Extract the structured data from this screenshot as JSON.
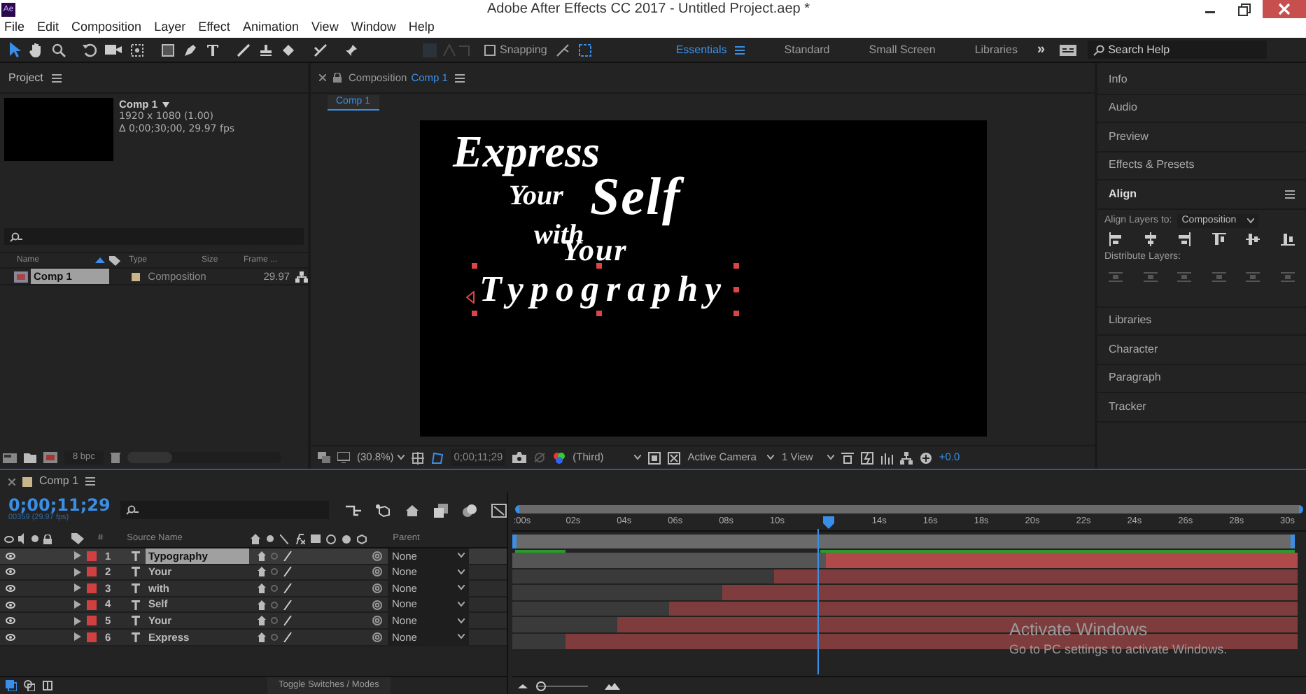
{
  "title_bar": {
    "app_icon": "Ae",
    "title": "Adobe After Effects CC 2017 - Untitled Project.aep *"
  },
  "menu": [
    "File",
    "Edit",
    "Composition",
    "Layer",
    "Effect",
    "Animation",
    "View",
    "Window",
    "Help"
  ],
  "toolbar": {
    "snapping": {
      "label": "Snapping",
      "checked": false
    },
    "workspaces": [
      {
        "label": "Essentials",
        "selected": true
      },
      {
        "label": "Standard",
        "selected": false
      },
      {
        "label": "Small Screen",
        "selected": false
      },
      {
        "label": "Libraries",
        "selected": false
      }
    ],
    "overflow": "»",
    "search": {
      "placeholder": "Search Help"
    }
  },
  "project": {
    "title": "Project",
    "comp_name": "Comp 1",
    "dimensions": "1920 x 1080 (1.00)",
    "duration": "Δ 0;00;30;00, 29.97 fps",
    "columns": [
      "Name",
      "Type",
      "Size",
      "Frame ..."
    ],
    "items": [
      {
        "name": "Comp 1",
        "type": "Composition",
        "frame_rate": "29.97",
        "selected": true
      }
    ],
    "bit_depth": "8 bpc",
    "thumbnail_slider": {
      "level": 0.0
    }
  },
  "viewer": {
    "tab_label": "Composition",
    "tab_comp": "Comp 1",
    "breadcrumb": "Comp 1",
    "canvas_texts": [
      "Express",
      "Your",
      "Self",
      "with",
      "Your",
      "Typography"
    ],
    "zoom": "(30.8%)",
    "timecode": "0;00;11;29",
    "resolution": "(Third)",
    "camera": "Active Camera",
    "views": "1 View",
    "exposure": "+0.0"
  },
  "right_panel": {
    "panels": [
      {
        "label": "Info",
        "expanded": false
      },
      {
        "label": "Audio",
        "expanded": false
      },
      {
        "label": "Preview",
        "expanded": false
      },
      {
        "label": "Effects & Presets",
        "expanded": false
      },
      {
        "label": "Align",
        "expanded": true
      },
      {
        "label": "Libraries",
        "expanded": false
      },
      {
        "label": "Character",
        "expanded": false
      },
      {
        "label": "Paragraph",
        "expanded": false
      },
      {
        "label": "Tracker",
        "expanded": false
      }
    ],
    "align_to_label": "Align Layers to:",
    "align_to": "Composition",
    "distribute_label": "Distribute Layers:"
  },
  "timeline": {
    "tab": "Comp 1",
    "timecode": "0;00;11;29",
    "frame_info": "00359 (29.97 fps)",
    "columns": {
      "number": "#",
      "source_name": "Source Name",
      "parent": "Parent"
    },
    "ruler": [
      {
        "kind": "tick",
        "label": ":00s"
      },
      {
        "kind": "tick",
        "label": "02s"
      },
      {
        "kind": "tick",
        "label": "04s"
      },
      {
        "kind": "tick",
        "label": "06s"
      },
      {
        "kind": "tick",
        "label": "08s"
      },
      {
        "kind": "tick",
        "label": "10s"
      },
      {
        "kind": "playhead"
      },
      {
        "kind": "tick",
        "label": "14s"
      },
      {
        "kind": "tick",
        "label": "16s"
      },
      {
        "kind": "tick",
        "label": "18s"
      },
      {
        "kind": "tick",
        "label": "20s"
      },
      {
        "kind": "tick",
        "label": "22s"
      },
      {
        "kind": "tick",
        "label": "24s"
      },
      {
        "kind": "tick",
        "label": "26s"
      },
      {
        "kind": "tick",
        "label": "28s"
      },
      {
        "kind": "tick",
        "label": "30s"
      }
    ],
    "layers": [
      {
        "number": "1",
        "name": "Typography",
        "parent": "None",
        "selected": true,
        "level": 0.6
      },
      {
        "number": "2",
        "name": "Your",
        "parent": "None",
        "selected": false,
        "level": 0.667
      },
      {
        "number": "3",
        "name": "with",
        "parent": "None",
        "selected": false,
        "level": 0.733
      },
      {
        "number": "4",
        "name": "Self",
        "parent": "None",
        "selected": false,
        "level": 0.8
      },
      {
        "number": "5",
        "name": "Your",
        "parent": "None",
        "selected": false,
        "level": 0.867
      },
      {
        "number": "6",
        "name": "Express",
        "parent": "None",
        "selected": false,
        "level": 0.933
      }
    ],
    "toggle": "Toggle Switches / Modes",
    "zoom_slider": {
      "level": 0.0
    }
  },
  "os_notice": {
    "title": "Activate Windows",
    "text": "Go to PC settings to activate Windows."
  }
}
